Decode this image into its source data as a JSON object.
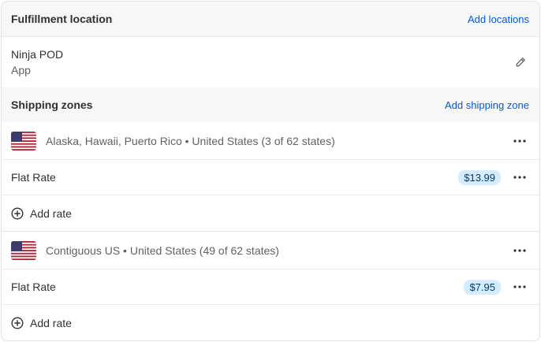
{
  "fulfillment": {
    "title": "Fulfillment location",
    "add_link": "Add locations",
    "location_name": "Ninja POD",
    "location_type": "App",
    "edit_icon": "pencil-icon"
  },
  "shipping": {
    "title": "Shipping zones",
    "add_link": "Add shipping zone",
    "zones": [
      {
        "label": "Alaska, Hawaii, Puerto Rico • United States (3 of 62 states)",
        "flag_icon": "us-flag-icon",
        "rate_name": "Flat Rate",
        "rate_price": "$13.99",
        "add_rate_label": "Add rate"
      },
      {
        "label": "Contiguous US • United States (49 of 62 states)",
        "flag_icon": "us-flag-icon",
        "rate_name": "Flat Rate",
        "rate_price": "$7.95",
        "add_rate_label": "Add rate"
      }
    ]
  },
  "colors": {
    "link": "#005bd3",
    "badge_bg": "#d5ebff",
    "header_bg": "#f7f7f7"
  }
}
